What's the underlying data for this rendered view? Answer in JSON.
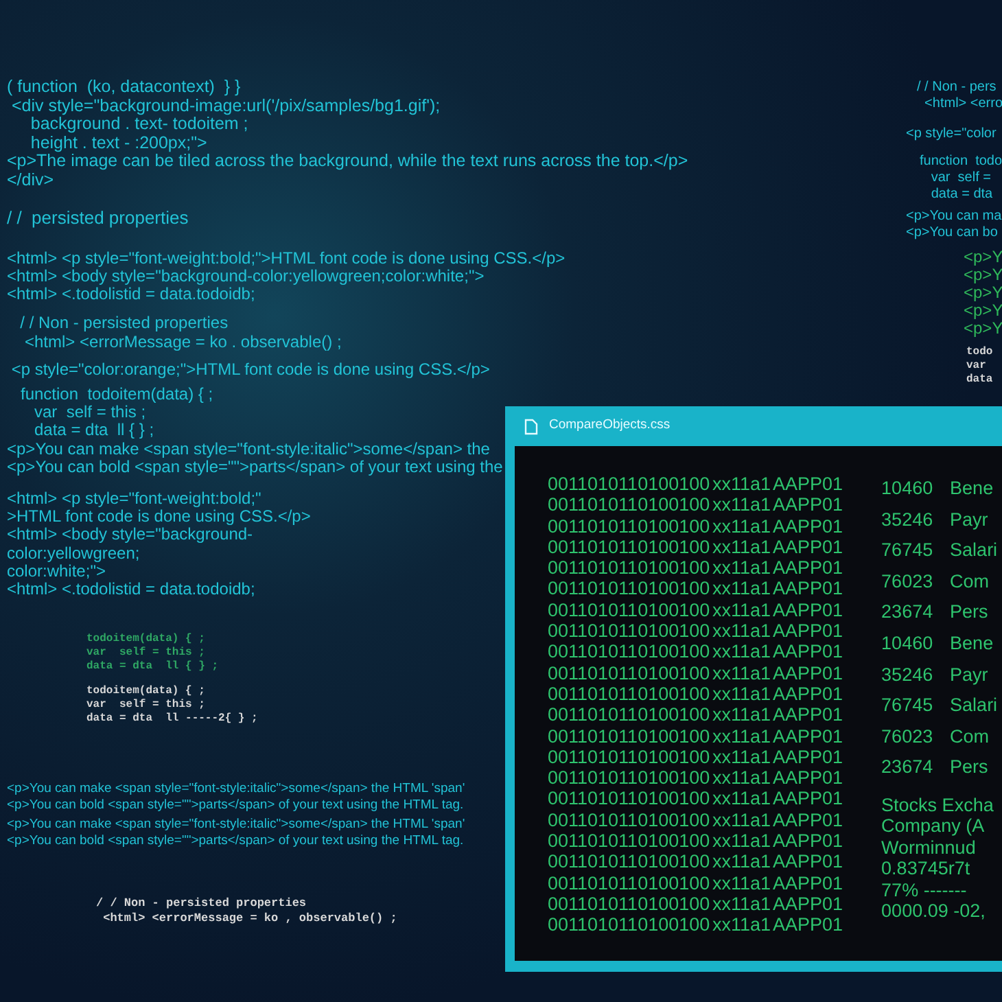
{
  "code_blocks": [
    {
      "kind": "sans",
      "color": "#22c3d6",
      "lines": [
        "( function  (ko, datacontext)  } }",
        " <div style=\"background-image:url('/pix/samples/bg1.gif');",
        "     background . text- todoitem ;",
        "     height . text - :200px;\">",
        "<p>The image can be tiled across the background, while the text runs across the top.</p>",
        "</div>"
      ]
    },
    {
      "kind": "sans",
      "color": "#22c3d6",
      "lines": [
        "/ /  persisted properties"
      ]
    },
    {
      "kind": "sans",
      "color": "#22c3d6",
      "lines": [
        "<html> <p style=\"font-weight:bold;\">HTML font code is done using CSS.</p>",
        "<html> <body style=\"background-color:yellowgreen;color:white;\">",
        "<html> <.todolistid = data.todoidb;"
      ]
    },
    {
      "kind": "sans",
      "color": "#22c3d6",
      "lines": [
        "  / / Non - persisted properties",
        "   <html> <errorMessage = ko . observable() ;"
      ]
    },
    {
      "kind": "sans",
      "color": "#22c3d6",
      "lines": [
        " <p style=\"color:orange;\">HTML font code is done using CSS.</p>"
      ]
    },
    {
      "kind": "sans",
      "color": "#22c3d6",
      "lines": [
        "   function  todoitem(data) { ;",
        "      var  self = this ;",
        "      data = dta  ll { } ;",
        "<p>You can make <span style=\"font-style:italic\">some</span> the",
        "<p>You can bold <span style=\"\">parts</span> of your text using the"
      ]
    },
    {
      "kind": "sans",
      "color": "#22c3d6",
      "lines": [
        "<html> <p style=\"font-weight:bold;\"",
        ">HTML font code is done using CSS.</p>",
        "<html> <body style=\"background-",
        "color:yellowgreen;",
        "color:white;\">",
        "<html> <.todolistid = data.todoidb;"
      ]
    },
    {
      "kind": "mono",
      "color": "#2fa864",
      "lines": [
        "todoitem(data) { ;",
        "var  self = this ;",
        "data = dta  ll { } ;"
      ]
    },
    {
      "kind": "mono",
      "color": "#d8d8d8",
      "lines": [
        "todoitem(data) { ;",
        "var  self = this ;",
        "data = dta  ll -----2{ } ;"
      ]
    },
    {
      "kind": "sans",
      "color": "#22c3d6",
      "lines": [
        "<p>You can make <span style=\"font-style:italic\">some</span> the HTML 'span'",
        "<p>You can bold <span style=\"\">parts</span> of your text using the HTML tag."
      ]
    },
    {
      "kind": "sans",
      "color": "#22c3d6",
      "lines": [
        "<p>You can make <span style=\"font-style:italic\">some</span> the HTML 'span'",
        "<p>You can bold <span style=\"\">parts</span> of your text using the HTML tag."
      ]
    },
    {
      "kind": "mono",
      "color": "#d8d8d8",
      "lines": [
        "/ / Non - persisted properties",
        " <html> <errorMessage = ko , observable() ;"
      ]
    },
    {
      "kind": "sans",
      "color": "#22c3d6",
      "lines": [
        "/ / Non - pers",
        "  <html> <erro"
      ]
    },
    {
      "kind": "sans",
      "color": "#22c3d6",
      "lines": [
        "<p style=\"color"
      ]
    },
    {
      "kind": "sans",
      "color": "#22c3d6",
      "lines": [
        "function  todo",
        "   var  self =",
        "   data = dta"
      ]
    },
    {
      "kind": "sans",
      "color": "#22c3d6",
      "lines": [
        "<p>You can ma",
        "<p>You can bo"
      ]
    },
    {
      "kind": "sans",
      "color": "#2fb85a",
      "lines": [
        "<p>Y",
        "<p>Y",
        "<p>Y",
        "<p>Y",
        "<p>Y"
      ]
    },
    {
      "kind": "mono",
      "color": "#d8d8d8",
      "lines": [
        "todo",
        "var",
        "data"
      ]
    }
  ],
  "window": {
    "title": "CompareObjects.css",
    "rows": [
      {
        "binary": "0011010110100100",
        "code": "xx11a1",
        "tag": "AAPP01"
      },
      {
        "binary": "0011010110100100",
        "code": "xx11a1",
        "tag": "AAPP01"
      },
      {
        "binary": "0011010110100100",
        "code": "xx11a1",
        "tag": "AAPP01"
      },
      {
        "binary": "0011010110100100",
        "code": "xx11a1",
        "tag": "AAPP01"
      },
      {
        "binary": "0011010110100100",
        "code": "xx11a1",
        "tag": "AAPP01"
      },
      {
        "binary": "0011010110100100",
        "code": "xx11a1",
        "tag": "AAPP01"
      },
      {
        "binary": "0011010110100100",
        "code": "xx11a1",
        "tag": "AAPP01"
      },
      {
        "binary": "0011010110100100",
        "code": "xx11a1",
        "tag": "AAPP01"
      },
      {
        "binary": "0011010110100100",
        "code": "xx11a1",
        "tag": "AAPP01"
      },
      {
        "binary": "0011010110100100",
        "code": "xx11a1",
        "tag": "AAPP01"
      },
      {
        "binary": "0011010110100100",
        "code": "xx11a1",
        "tag": "AAPP01"
      },
      {
        "binary": "0011010110100100",
        "code": "xx11a1",
        "tag": "AAPP01"
      },
      {
        "binary": "0011010110100100",
        "code": "xx11a1",
        "tag": "AAPP01"
      },
      {
        "binary": "0011010110100100",
        "code": "xx11a1",
        "tag": "AAPP01"
      },
      {
        "binary": "0011010110100100",
        "code": "xx11a1",
        "tag": "AAPP01"
      },
      {
        "binary": "0011010110100100",
        "code": "xx11a1",
        "tag": "AAPP01"
      },
      {
        "binary": "0011010110100100",
        "code": "xx11a1",
        "tag": "AAPP01"
      },
      {
        "binary": "0011010110100100",
        "code": "xx11a1",
        "tag": "AAPP01"
      },
      {
        "binary": "0011010110100100",
        "code": "xx11a1",
        "tag": "AAPP01"
      },
      {
        "binary": "0011010110100100",
        "code": "xx11a1",
        "tag": "AAPP01"
      },
      {
        "binary": "0011010110100100",
        "code": "xx11a1",
        "tag": "AAPP01"
      },
      {
        "binary": "0011010110100100",
        "code": "xx11a1",
        "tag": "AAPP01"
      }
    ],
    "accounts": [
      {
        "number": "10460",
        "name": "Bene"
      },
      {
        "number": "35246",
        "name": "Payr"
      },
      {
        "number": "76745",
        "name": "Salari"
      },
      {
        "number": "76023",
        "name": "Com"
      },
      {
        "number": "23674",
        "name": "Pers"
      },
      {
        "number": "10460",
        "name": "Bene"
      },
      {
        "number": "35246",
        "name": "Payr"
      },
      {
        "number": "76745",
        "name": "Salari"
      },
      {
        "number": "76023",
        "name": "Com"
      },
      {
        "number": "23674",
        "name": "Pers"
      }
    ],
    "notes": [
      "Stocks Excha",
      "Company (A",
      "Worminnud",
      "0.83745r7t",
      "77% -------",
      "0000.09 -02,"
    ]
  }
}
